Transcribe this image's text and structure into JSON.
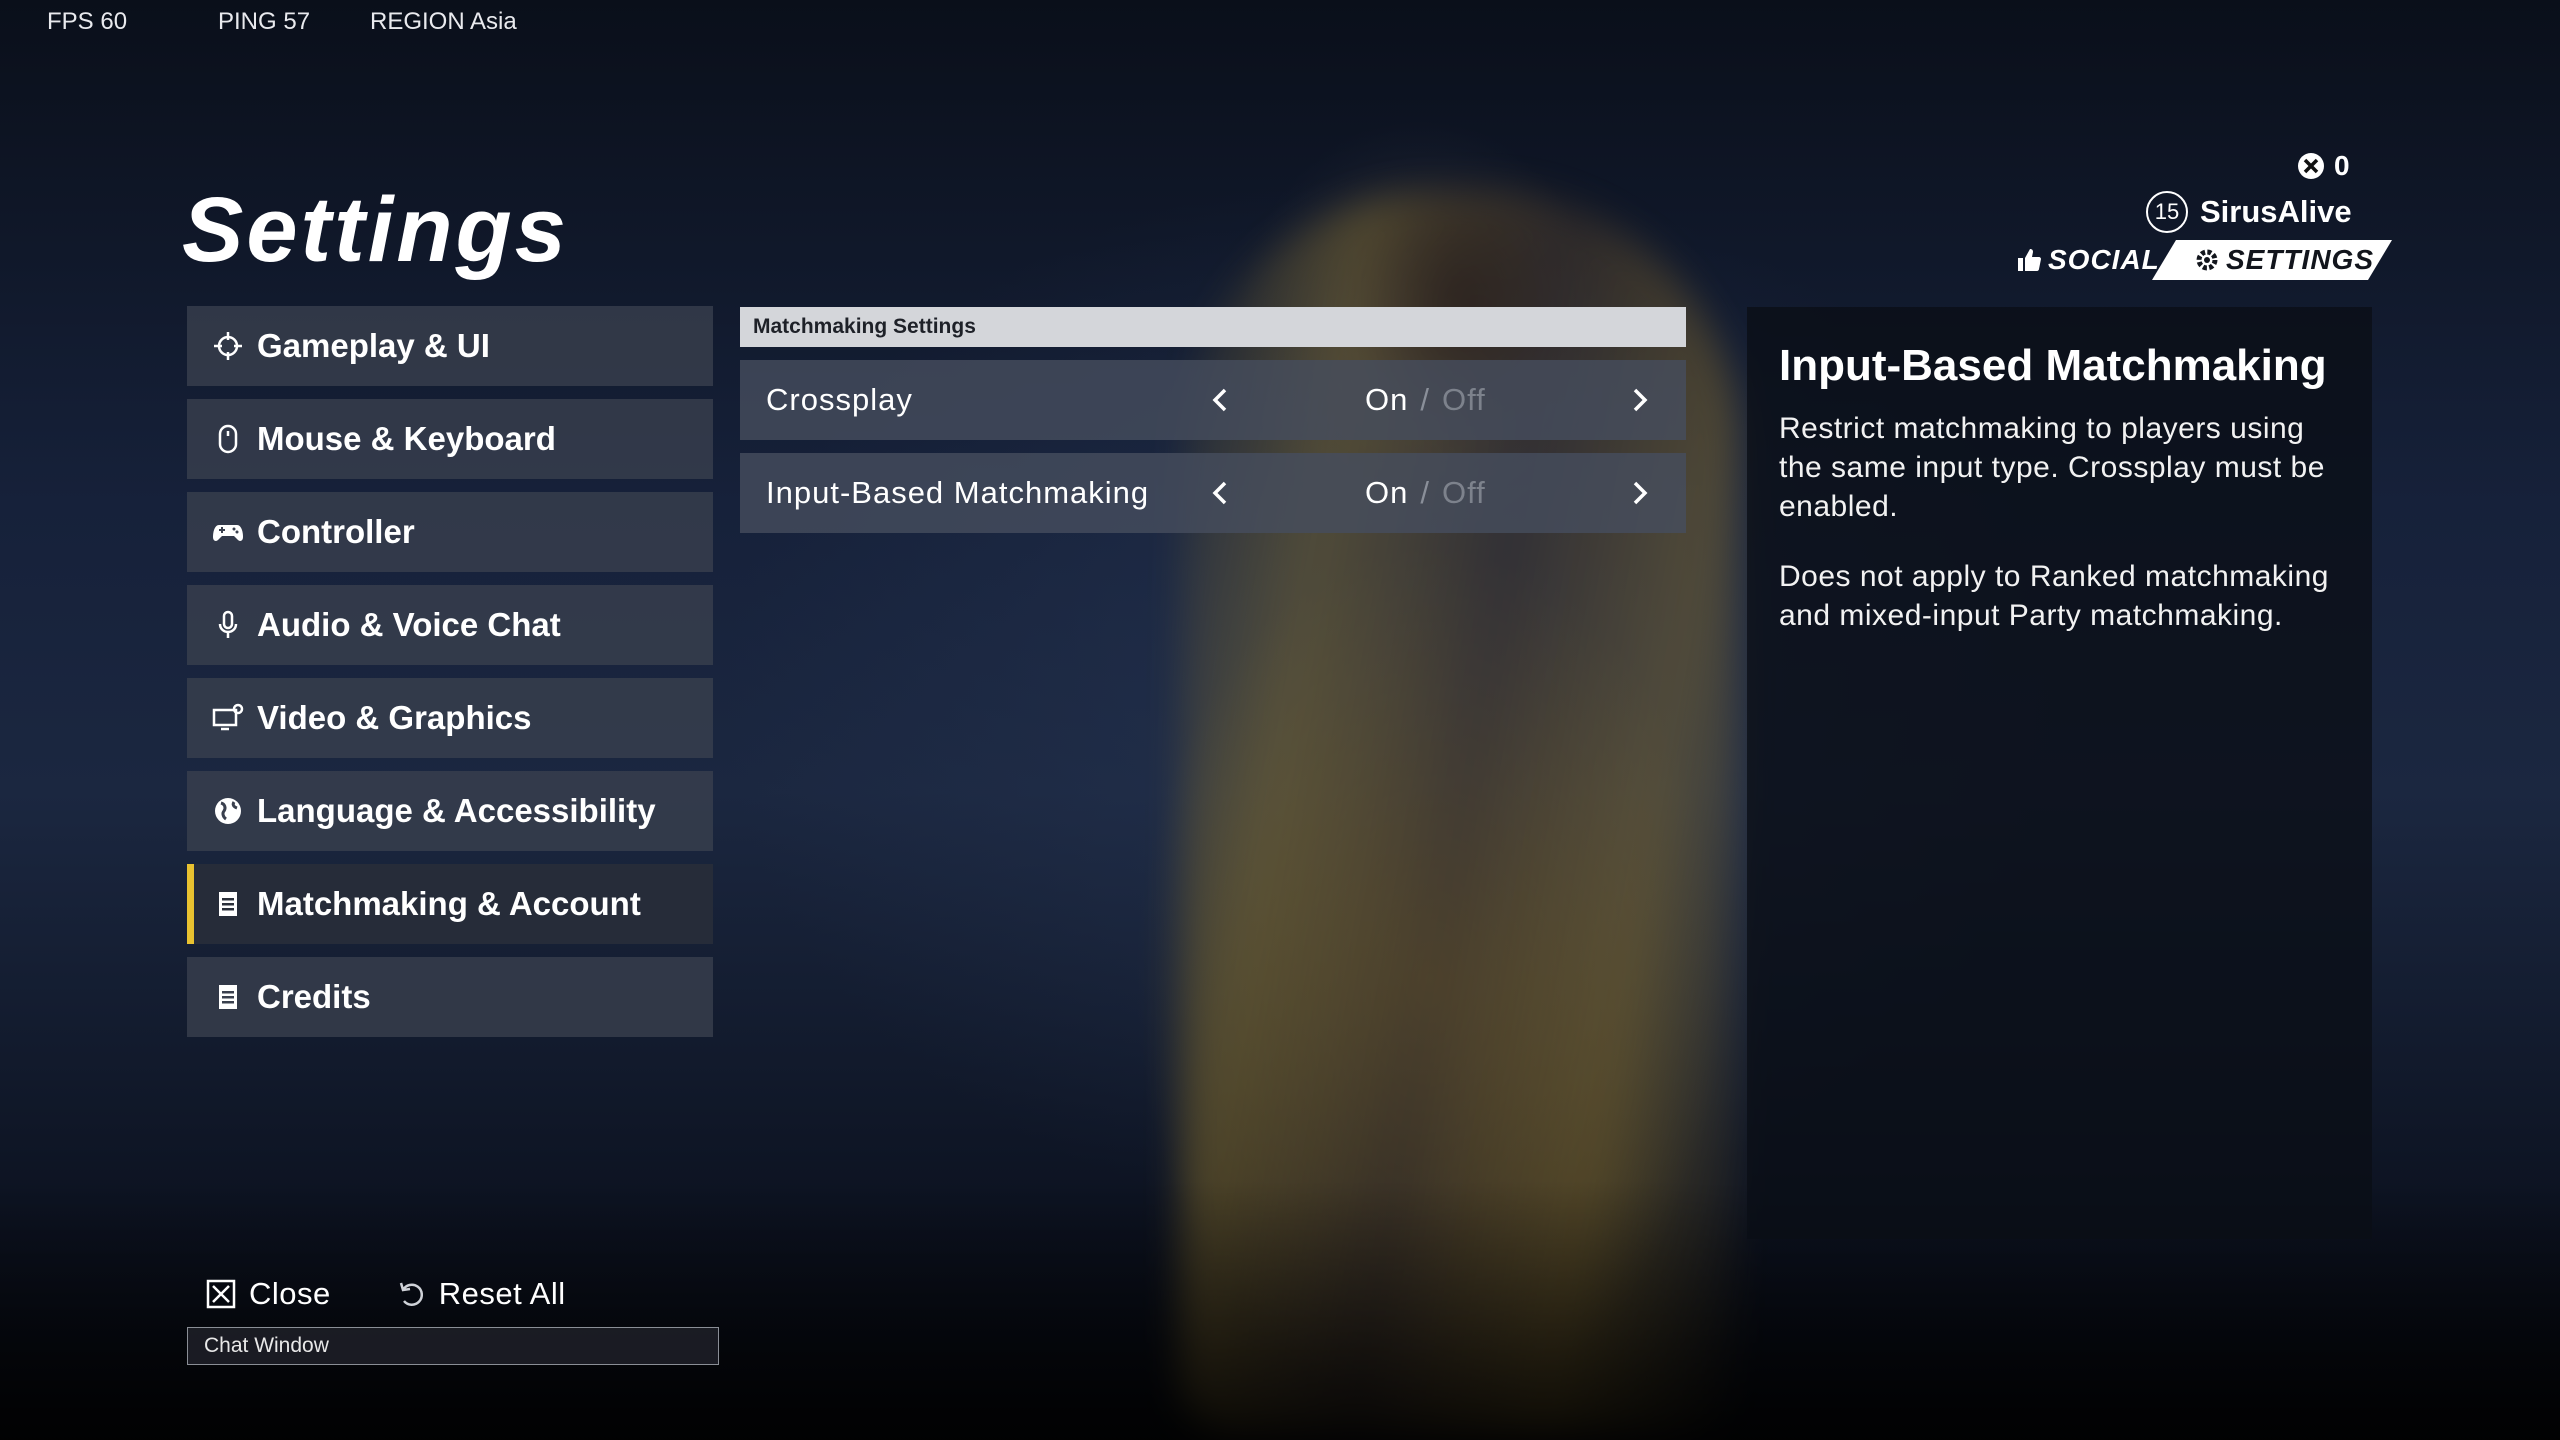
{
  "hud": {
    "fps": "FPS 60",
    "ping": "PING 57",
    "region": "REGION Asia"
  },
  "page_title": "Settings",
  "nav": {
    "items": [
      {
        "label": "Gameplay & UI",
        "icon": "crosshair-icon"
      },
      {
        "label": "Mouse & Keyboard",
        "icon": "mouse-icon"
      },
      {
        "label": "Controller",
        "icon": "gamepad-icon"
      },
      {
        "label": "Audio & Voice Chat",
        "icon": "microphone-icon"
      },
      {
        "label": "Video & Graphics",
        "icon": "monitor-gear-icon"
      },
      {
        "label": "Language & Accessibility",
        "icon": "globe-icon"
      },
      {
        "label": "Matchmaking & Account",
        "icon": "document-icon",
        "active": true
      },
      {
        "label": "Credits",
        "icon": "document-icon"
      }
    ]
  },
  "panel": {
    "header": "Matchmaking Settings",
    "rows": [
      {
        "label": "Crossplay",
        "on": "On",
        "sep": "/",
        "off": "Off"
      },
      {
        "label": "Input-Based Matchmaking",
        "on": "On",
        "sep": "/",
        "off": "Off"
      }
    ]
  },
  "info": {
    "title": "Input-Based Matchmaking",
    "paragraph1": "Restrict matchmaking to players using the same input type. Crossplay must be enabled.",
    "paragraph2": "Does not apply to Ranked matchmaking and mixed-input Party matchmaking."
  },
  "user": {
    "counter": "0",
    "level": "15",
    "name": "SirusAlive",
    "tab_social": "SOCIAL",
    "tab_settings": "SETTINGS"
  },
  "footer": {
    "close_label": "Close",
    "reset_label": "Reset All",
    "chat_window": "Chat Window"
  },
  "colors": {
    "accent": "#e9c230",
    "panel_header_bg": "#d4d6da"
  }
}
